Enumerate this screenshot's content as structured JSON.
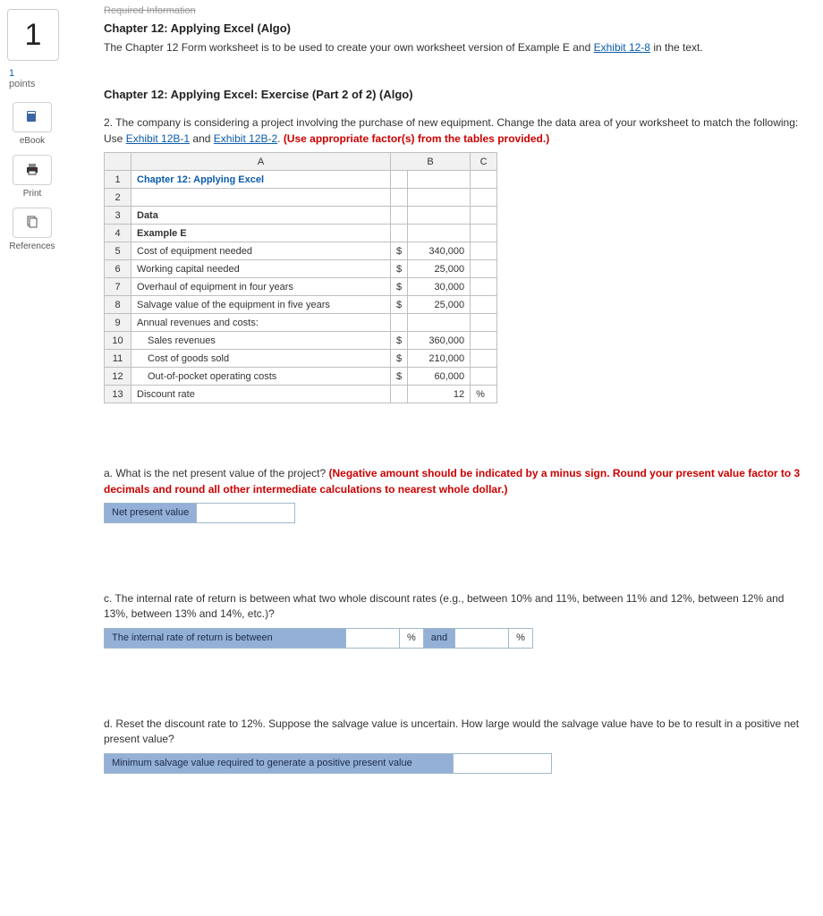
{
  "sidebar": {
    "question_number": "1",
    "points_num": "1",
    "points_label": "points",
    "tools": {
      "ebook": "eBook",
      "print": "Print",
      "references": "References"
    }
  },
  "header": {
    "req_info": "Required Information",
    "title": "Chapter 12: Applying Excel (Algo)",
    "intro_a": "The Chapter 12 Form worksheet is to be used to create your own worksheet version of Example E and ",
    "exhibit_link": "Exhibit 12-8",
    "intro_b": " in the text."
  },
  "exercise": {
    "title": "Chapter 12: Applying Excel: Exercise (Part 2 of 2) (Algo)",
    "p2_a": "2. The company is considering a project involving the purchase of new equipment. Change the data area of your worksheet to match the following: Use ",
    "link1": "Exhibit 12B-1",
    "and": " and ",
    "link2": "Exhibit 12B-2",
    "p2_b": ". ",
    "p2_red": "(Use appropriate factor(s) from the tables provided.)"
  },
  "sheet": {
    "colA": "A",
    "colB": "B",
    "colC": "C",
    "rows": [
      {
        "n": "1",
        "a": "Chapter 12: Applying Excel",
        "cls": "hdr-cell",
        "cur": "",
        "b": "",
        "c": ""
      },
      {
        "n": "2",
        "a": "",
        "cur": "",
        "b": "",
        "c": ""
      },
      {
        "n": "3",
        "a": "Data",
        "bold": true,
        "cur": "",
        "b": "",
        "c": ""
      },
      {
        "n": "4",
        "a": "Example E",
        "bold": true,
        "cur": "",
        "b": "",
        "c": ""
      },
      {
        "n": "5",
        "a": "Cost of equipment needed",
        "cur": "$",
        "b": "340,000",
        "c": ""
      },
      {
        "n": "6",
        "a": "Working capital needed",
        "cur": "$",
        "b": "25,000",
        "c": ""
      },
      {
        "n": "7",
        "a": "Overhaul of equipment in four years",
        "cur": "$",
        "b": "30,000",
        "c": ""
      },
      {
        "n": "8",
        "a": "Salvage value of the equipment in five years",
        "cur": "$",
        "b": "25,000",
        "c": ""
      },
      {
        "n": "9",
        "a": "Annual revenues and costs:",
        "cur": "",
        "b": "",
        "c": ""
      },
      {
        "n": "10",
        "a": "Sales revenues",
        "indent": true,
        "cur": "$",
        "b": "360,000",
        "c": ""
      },
      {
        "n": "11",
        "a": "Cost of goods sold",
        "indent": true,
        "cur": "$",
        "b": "210,000",
        "c": ""
      },
      {
        "n": "12",
        "a": "Out-of-pocket operating costs",
        "indent": true,
        "cur": "$",
        "b": "60,000",
        "c": ""
      },
      {
        "n": "13",
        "a": "Discount rate",
        "cur": "",
        "b": "12",
        "c": "%"
      }
    ]
  },
  "qa": {
    "a_text": "a. What is the net present value of the project? ",
    "a_red": "(Negative amount should be indicated by a minus sign. Round your present value factor to 3 decimals and round all other intermediate calculations to nearest whole dollar.)",
    "a_label": "Net present value",
    "c_text": "c. The internal rate of return is between what two whole discount rates (e.g., between 10% and 11%, between 11% and 12%, between 12% and 13%, between 13% and 14%, etc.)?",
    "c_label": "The internal rate of return is between",
    "c_pct": "%",
    "c_and": "and",
    "d_text": "d. Reset the discount rate to 12%. Suppose the salvage value is uncertain. How large would the salvage value have to be to result in a positive net present value?",
    "d_label": "Minimum salvage value required to generate a positive present value"
  }
}
